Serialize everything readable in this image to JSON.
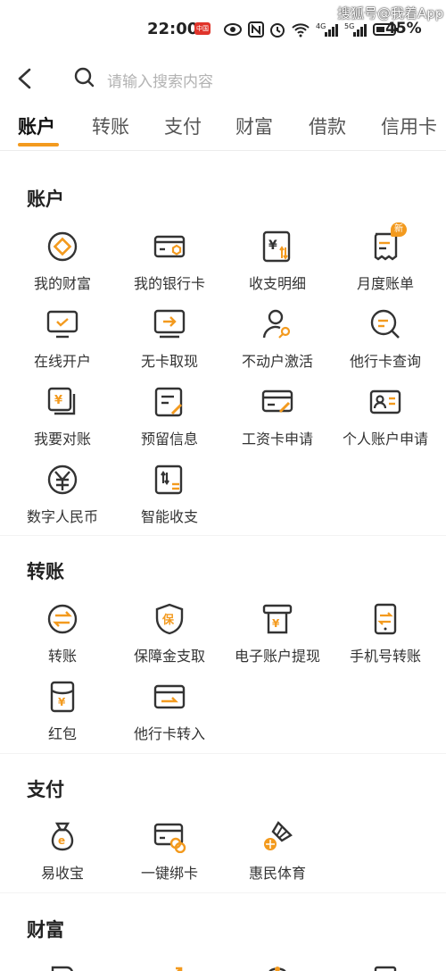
{
  "status_bar": {
    "time": "22:00",
    "badge": "中国联",
    "battery": "45%",
    "watermark": "搜狐号@我着App"
  },
  "search": {
    "placeholder": "请输入搜索内容"
  },
  "tabs": [
    "账户",
    "转账",
    "支付",
    "财富",
    "借款",
    "信用卡"
  ],
  "sections": {
    "account": {
      "title": "账户",
      "items": [
        "我的财富",
        "我的银行卡",
        "收支明细",
        "月度账单",
        "在线开户",
        "无卡取现",
        "不动户激活",
        "他行卡查询",
        "我要对账",
        "预留信息",
        "工资卡申请",
        "个人账户申请",
        "数字人民币",
        "智能收支"
      ],
      "new_badge": "新"
    },
    "transfer": {
      "title": "转账",
      "items": [
        "转账",
        "保障金支取",
        "电子账户提现",
        "手机号转账",
        "红包",
        "他行卡转入"
      ]
    },
    "pay": {
      "title": "支付",
      "items": [
        "易收宝",
        "一键绑卡",
        "惠民体育"
      ]
    },
    "wealth": {
      "title": "财富"
    }
  },
  "colors": {
    "accent": "#f39a1e",
    "ink": "#333333"
  }
}
